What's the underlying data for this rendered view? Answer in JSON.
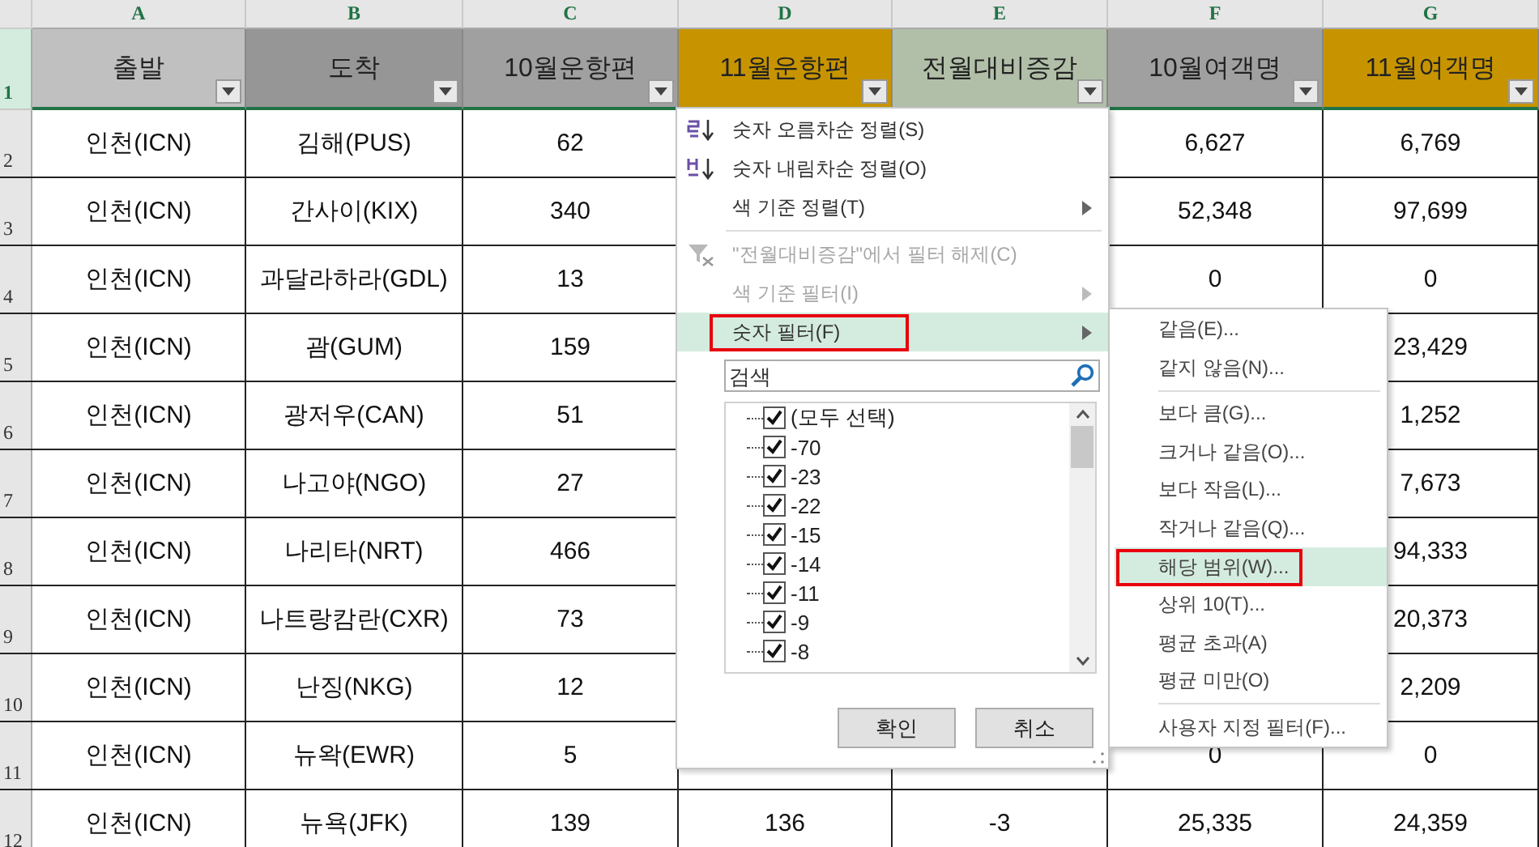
{
  "columns": [
    {
      "letter": "A",
      "header": "출발",
      "color": "#c0c0c0"
    },
    {
      "letter": "B",
      "header": "도착",
      "color": "#969696"
    },
    {
      "letter": "C",
      "header": "10월운항편",
      "color": "#a0a0a0"
    },
    {
      "letter": "D",
      "header": "11월운항편",
      "color": "#c79400"
    },
    {
      "letter": "E",
      "header": "전월대비증감",
      "color": "#b2bfa8"
    },
    {
      "letter": "F",
      "header": "10월여객명",
      "color": "#a0a0a0"
    },
    {
      "letter": "G",
      "header": "11월여객명",
      "color": "#c79400"
    }
  ],
  "header_row": {
    "number": "1",
    "selected": true
  },
  "rows": [
    {
      "number": "2",
      "cells": {
        "A": "인천(ICN)",
        "B": "김해(PUS)",
        "C": "62",
        "F": "6,627",
        "G": "6,769"
      }
    },
    {
      "number": "3",
      "cells": {
        "A": "인천(ICN)",
        "B": "간사이(KIX)",
        "C": "340",
        "F": "52,348",
        "G": "97,699"
      }
    },
    {
      "number": "4",
      "cells": {
        "A": "인천(ICN)",
        "B": "과달라하라(GDL)",
        "C": "13",
        "F": "0",
        "G": "0"
      }
    },
    {
      "number": "5",
      "cells": {
        "A": "인천(ICN)",
        "B": "괌(GUM)",
        "C": "159",
        "G": "23,429"
      }
    },
    {
      "number": "6",
      "cells": {
        "A": "인천(ICN)",
        "B": "광저우(CAN)",
        "C": "51",
        "G": "1,252"
      }
    },
    {
      "number": "7",
      "cells": {
        "A": "인천(ICN)",
        "B": "나고야(NGO)",
        "C": "27",
        "G": "7,673"
      }
    },
    {
      "number": "8",
      "cells": {
        "A": "인천(ICN)",
        "B": "나리타(NRT)",
        "C": "466",
        "G": "94,333"
      }
    },
    {
      "number": "9",
      "cells": {
        "A": "인천(ICN)",
        "B": "나트랑캄란(CXR)",
        "C": "73",
        "G": "20,373"
      }
    },
    {
      "number": "10",
      "cells": {
        "A": "인천(ICN)",
        "B": "난징(NKG)",
        "C": "12",
        "G": "2,209"
      }
    },
    {
      "number": "11",
      "cells": {
        "A": "인천(ICN)",
        "B": "뉴왁(EWR)",
        "C": "5",
        "F": "0",
        "G": "0"
      }
    },
    {
      "number": "12",
      "cells": {
        "A": "인천(ICN)",
        "B": "뉴욕(JFK)",
        "C": "139",
        "D": "136",
        "E": "-3",
        "F": "25,335",
        "G": "24,359"
      }
    }
  ],
  "filter_menu": {
    "items": [
      {
        "kind": "sort_asc",
        "label": "숫자 오름차순 정렬(S)",
        "disabled": false,
        "submenu": false,
        "highlighted": false,
        "outlined": false,
        "separator_before": false
      },
      {
        "kind": "sort_desc",
        "label": "숫자 내림차순 정렬(O)",
        "disabled": false,
        "submenu": false,
        "highlighted": false,
        "outlined": false,
        "separator_before": false
      },
      {
        "kind": "plain",
        "label": "색 기준 정렬(T)",
        "disabled": false,
        "submenu": true,
        "highlighted": false,
        "outlined": false,
        "separator_before": false
      },
      {
        "kind": "clear_filter",
        "label": "\"전월대비증감\"에서 필터 해제(C)",
        "disabled": true,
        "submenu": false,
        "highlighted": false,
        "outlined": false,
        "separator_before": true
      },
      {
        "kind": "plain",
        "label": "색 기준 필터(I)",
        "disabled": true,
        "submenu": true,
        "highlighted": false,
        "outlined": false,
        "separator_before": false
      },
      {
        "kind": "plain",
        "label": "숫자 필터(F)",
        "disabled": false,
        "submenu": true,
        "highlighted": true,
        "outlined": true,
        "separator_before": false
      }
    ],
    "search": {
      "placeholder": "검색"
    },
    "values": [
      {
        "label": "(모두 선택)",
        "checked": true
      },
      {
        "label": "-70",
        "checked": true
      },
      {
        "label": "-23",
        "checked": true
      },
      {
        "label": "-22",
        "checked": true
      },
      {
        "label": "-15",
        "checked": true
      },
      {
        "label": "-14",
        "checked": true
      },
      {
        "label": "-11",
        "checked": true
      },
      {
        "label": "-9",
        "checked": true
      },
      {
        "label": "-8",
        "checked": true
      }
    ],
    "buttons": [
      "확인",
      "취소"
    ]
  },
  "number_filter_menu": {
    "items": [
      {
        "label": "같음(E)...",
        "highlighted": false,
        "outlined": false,
        "separator_before": false
      },
      {
        "label": "같지 않음(N)...",
        "highlighted": false,
        "outlined": false,
        "separator_before": false
      },
      {
        "label": "보다 큼(G)...",
        "highlighted": false,
        "outlined": false,
        "separator_before": true
      },
      {
        "label": "크거나 같음(O)...",
        "highlighted": false,
        "outlined": false,
        "separator_before": false
      },
      {
        "label": "보다 작음(L)...",
        "highlighted": false,
        "outlined": false,
        "separator_before": false
      },
      {
        "label": "작거나 같음(Q)...",
        "highlighted": false,
        "outlined": false,
        "separator_before": false
      },
      {
        "label": "해당 범위(W)...",
        "highlighted": true,
        "outlined": true,
        "separator_before": false
      },
      {
        "label": "상위 10(T)...",
        "highlighted": false,
        "outlined": false,
        "separator_before": false
      },
      {
        "label": "평균 초과(A)",
        "highlighted": false,
        "outlined": false,
        "separator_before": false
      },
      {
        "label": "평균 미만(O)",
        "highlighted": false,
        "outlined": false,
        "separator_before": false
      },
      {
        "label": "사용자 지정 필터(F)...",
        "highlighted": false,
        "outlined": false,
        "separator_before": true
      }
    ]
  }
}
